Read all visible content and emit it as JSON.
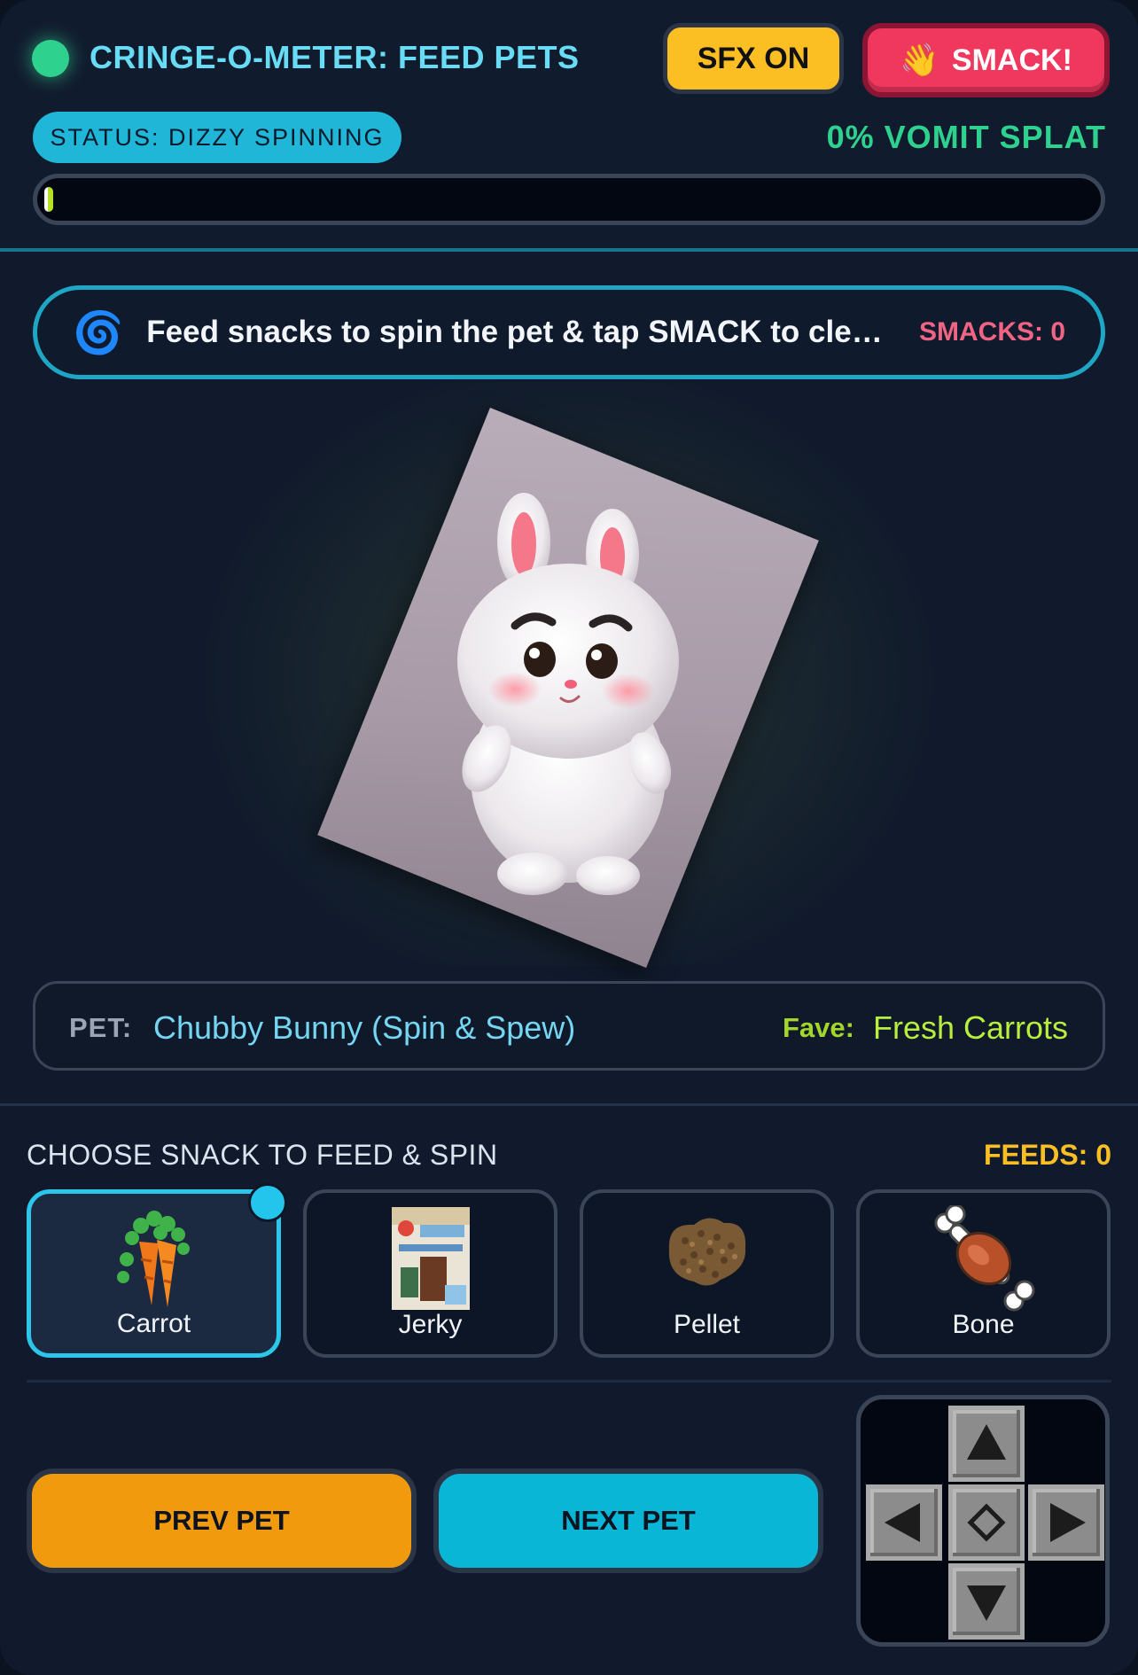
{
  "header": {
    "title": "CRINGE-O-METER: FEED PETS",
    "sfx_label": "SFX ON",
    "smack_label": "SMACK!",
    "smack_icon": "waving-hand-icon",
    "status": "STATUS: DIZZY SPINNING",
    "vomit_readout": "0% VOMIT SPLAT",
    "vomit_percent": 0
  },
  "banner": {
    "icon": "spiral-icon",
    "text": "Feed snacks to spin the pet & tap SMACK to cle…",
    "smack_count": "SMACKS: 0"
  },
  "pet": {
    "label": "PET:",
    "name": "Chubby Bunny (Spin & Spew)",
    "fave_label": "Fave:",
    "fave_value": "Fresh Carrots"
  },
  "snacks": {
    "heading": "CHOOSE SNACK TO FEED & SPIN",
    "feeds": "FEEDS: 0",
    "items": [
      {
        "label": "Carrot",
        "icon": "carrot-icon",
        "selected": true
      },
      {
        "label": "Jerky",
        "icon": "jerky-pack-icon",
        "selected": false
      },
      {
        "label": "Pellet",
        "icon": "pellet-pile-icon",
        "selected": false
      },
      {
        "label": "Bone",
        "icon": "meat-bone-icon",
        "selected": false
      }
    ]
  },
  "nav": {
    "prev_label": "PREV PET",
    "next_label": "NEXT PET"
  },
  "dpad": {
    "keys": [
      "up-arrow-icon",
      "left-arrow-icon",
      "center-diamond-icon",
      "right-arrow-icon",
      "down-arrow-icon"
    ]
  },
  "colors": {
    "accent_cyan": "#1fb6d8",
    "smack_red": "#f0385e",
    "sfx_yellow": "#fbbf24",
    "vomit_green": "#2fd18f",
    "prev_orange": "#f29a0e",
    "next_cyan": "#0ab6d6"
  }
}
